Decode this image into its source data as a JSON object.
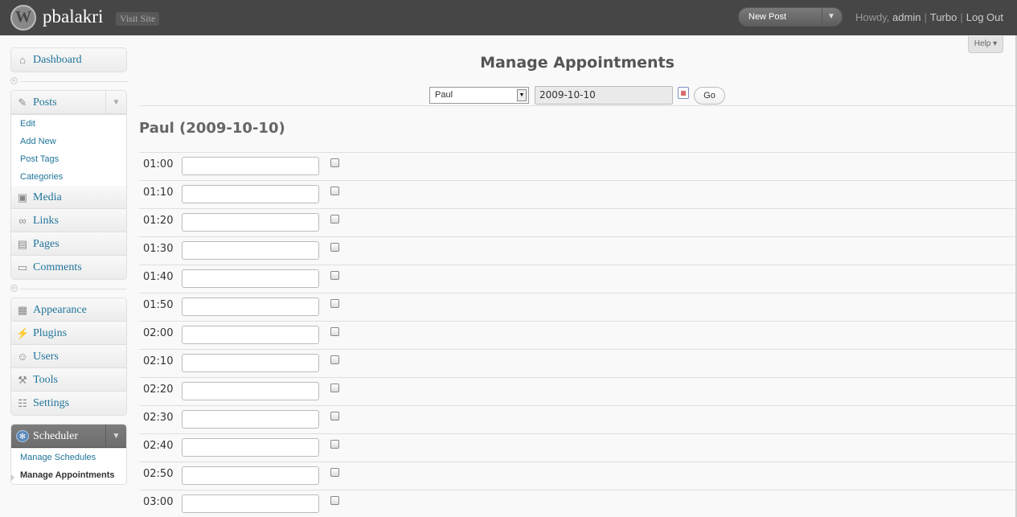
{
  "header": {
    "site_title": "pbalakri",
    "visit_site": "Visit Site",
    "new_post": "New Post",
    "howdy": "Howdy,",
    "user": "admin",
    "turbo": "Turbo",
    "logout": "Log Out",
    "sep": "|"
  },
  "help": "Help",
  "sidebar": {
    "dashboard": "Dashboard",
    "posts": "Posts",
    "posts_sub": [
      "Edit",
      "Add New",
      "Post Tags",
      "Categories"
    ],
    "media": "Media",
    "links": "Links",
    "pages": "Pages",
    "comments": "Comments",
    "appearance": "Appearance",
    "plugins": "Plugins",
    "users": "Users",
    "tools": "Tools",
    "settings": "Settings",
    "scheduler": "Scheduler",
    "scheduler_sub": [
      "Manage Schedules",
      "Manage Appointments"
    ]
  },
  "main": {
    "title": "Manage Appointments",
    "person_selected": "Paul",
    "date_value": "2009-10-10",
    "go_label": "Go",
    "section_title": "Paul (2009-10-10)",
    "slots": [
      "01:00",
      "01:10",
      "01:20",
      "01:30",
      "01:40",
      "01:50",
      "02:00",
      "02:10",
      "02:20",
      "02:30",
      "02:40",
      "02:50",
      "03:00"
    ]
  },
  "colors": {
    "header_bg": "#464646",
    "link": "#21759b",
    "scheduler_bg": "#777777"
  }
}
